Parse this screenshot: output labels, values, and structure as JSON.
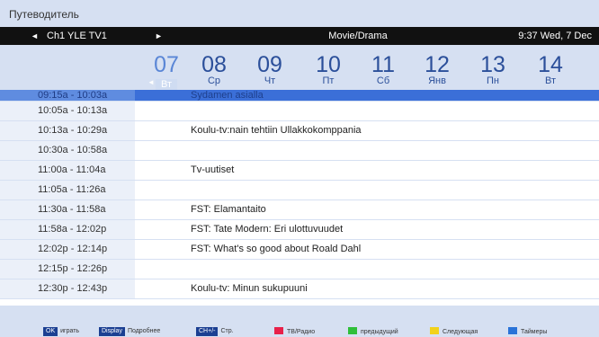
{
  "window_title": "Путеводитель",
  "nav": {
    "left_arrow": "◄",
    "channel": "Ch1 YLE TV1",
    "right_arrow": "►",
    "genre": "Movie/Drama",
    "clock": "9:37 Wed, 7 Dec"
  },
  "dates": [
    {
      "num": "07",
      "day": "Вт"
    },
    {
      "num": "08",
      "day": "Ср"
    },
    {
      "num": "09",
      "day": "Чт"
    },
    {
      "num": "10",
      "day": "Пт"
    },
    {
      "num": "11",
      "day": "Сб"
    },
    {
      "num": "12",
      "day": "Янв"
    },
    {
      "num": "13",
      "day": "Пн"
    },
    {
      "num": "14",
      "day": "Вт"
    }
  ],
  "date_left_tick": "◄",
  "rows": [
    {
      "time": "09:15a - 10:03a",
      "title": "Sydamen asialla"
    },
    {
      "time": "10:05a - 10:13a",
      "title": ""
    },
    {
      "time": "10:13a - 10:29a",
      "title": "Koulu-tv:nain tehtiin Ullakkokomppania"
    },
    {
      "time": "10:30a - 10:58a",
      "title": ""
    },
    {
      "time": "11:00a - 11:04a",
      "title": "Tv-uutiset"
    },
    {
      "time": "11:05a - 11:26a",
      "title": ""
    },
    {
      "time": "11:30a - 11:58a",
      "title": "FST: Elamantaito"
    },
    {
      "time": "11:58a - 12:02p",
      "title": "FST: Tate Modern: Eri ulottuvuudet"
    },
    {
      "time": "12:02p - 12:14p",
      "title": "FST: What's so good about Roald Dahl"
    },
    {
      "time": "12:15p - 12:26p",
      "title": ""
    },
    {
      "time": "12:30p - 12:43p",
      "title": "Koulu-tv: Minun sukupuuni"
    }
  ],
  "footer": {
    "ok_key": "OK",
    "ok_label": "играть",
    "display_key": "Display",
    "display_label": "Подробнее",
    "ch_key": "CH+/-",
    "ch_label": "Стр.",
    "red_label": "ТВ/Радио",
    "green_label": "предыдущий",
    "yellow_label": "Следующая",
    "blue_label": "Таймеры"
  },
  "colors": {
    "red": "#e8204a",
    "green": "#2fbf3a",
    "yellow": "#f2d21b",
    "blue": "#2a73d8"
  }
}
